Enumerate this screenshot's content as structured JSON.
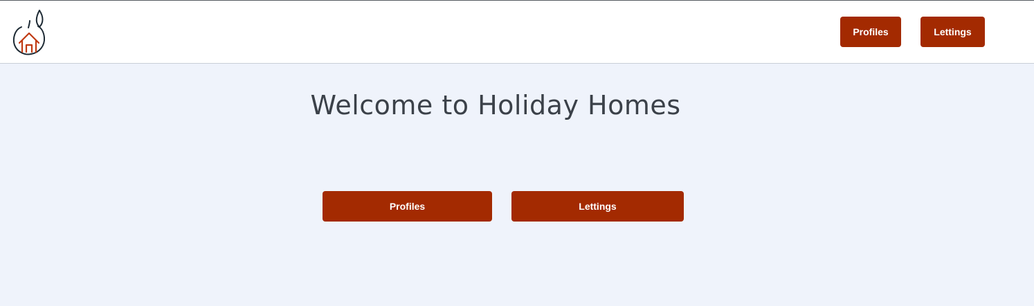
{
  "header": {
    "logo_icon": "orange-house-logo-icon",
    "nav": [
      {
        "label": "Profiles"
      },
      {
        "label": "Lettings"
      }
    ]
  },
  "main": {
    "title": "Welcome to Holiday Homes",
    "buttons": [
      {
        "label": "Profiles"
      },
      {
        "label": "Lettings"
      }
    ]
  },
  "colors": {
    "accent": "#a32a01",
    "page_background": "#eff3fb",
    "header_background": "#ffffff",
    "title_text": "#3b4149"
  }
}
